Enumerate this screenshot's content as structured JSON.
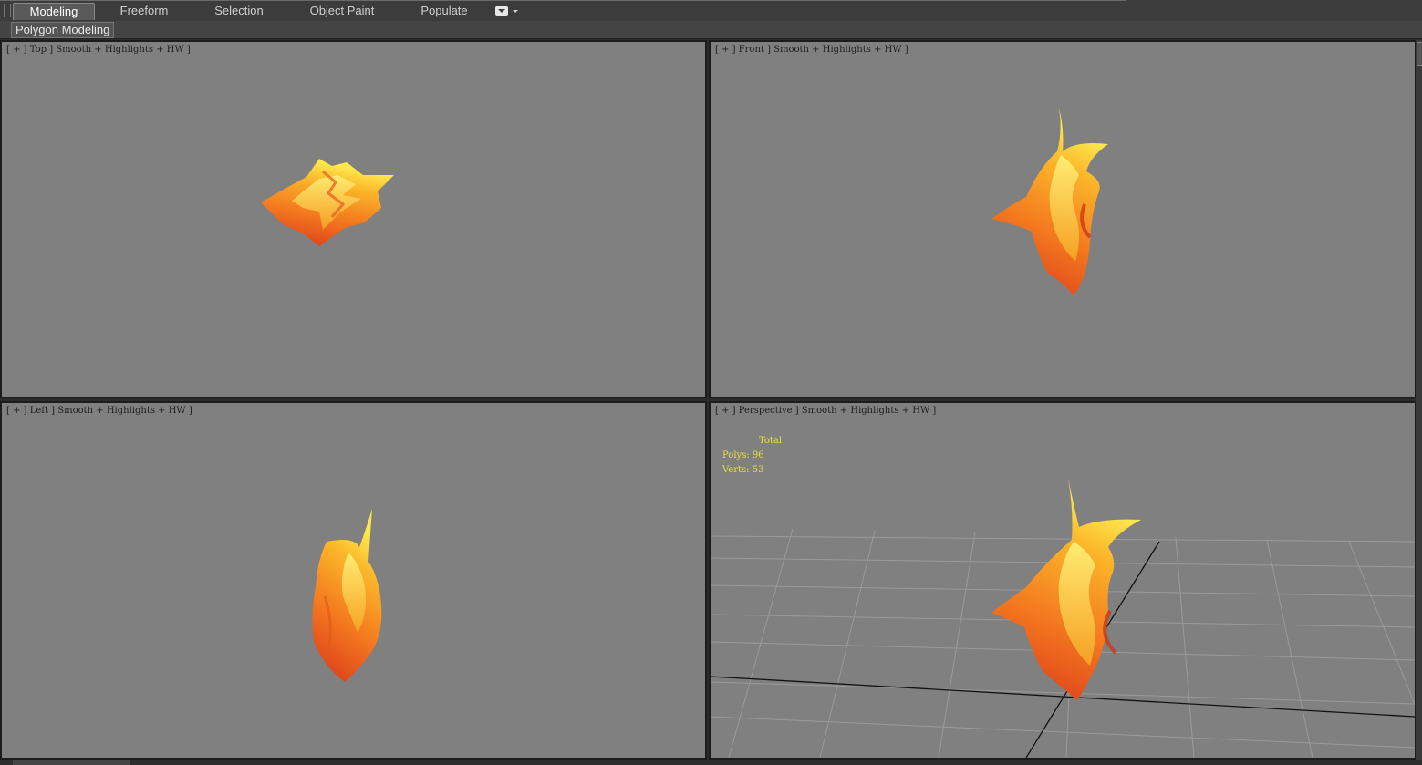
{
  "ribbon": {
    "tabs": [
      {
        "label": "Modeling",
        "active": true
      },
      {
        "label": "Freeform",
        "active": false
      },
      {
        "label": "Selection",
        "active": false
      },
      {
        "label": "Object Paint",
        "active": false
      },
      {
        "label": "Populate",
        "active": false
      }
    ],
    "dropdown_icon": "ribbon-options-icon"
  },
  "panel": {
    "label": "Polygon Modeling"
  },
  "viewports": [
    {
      "id": "top",
      "label": "[ + ] Top ] Smooth + Highlights + HW ]"
    },
    {
      "id": "front",
      "label": "[ + ] Front ] Smooth + Highlights + HW ]"
    },
    {
      "id": "left",
      "label": "[ + ] Left ] Smooth + Highlights + HW ]"
    },
    {
      "id": "perspective",
      "label": "[ + ] Perspective ] Smooth + Highlights + HW ]"
    }
  ],
  "stats": {
    "header": "Total",
    "polys": "Polys: 96",
    "verts": "Verts: 53"
  },
  "colors": {
    "viewport_bg": "#808080",
    "ui_bg": "#2b2b2b",
    "flame_outer": "#e8441a",
    "flame_mid": "#f7931e",
    "flame_inner": "#fde74c",
    "stats_text": "#e8e238"
  }
}
